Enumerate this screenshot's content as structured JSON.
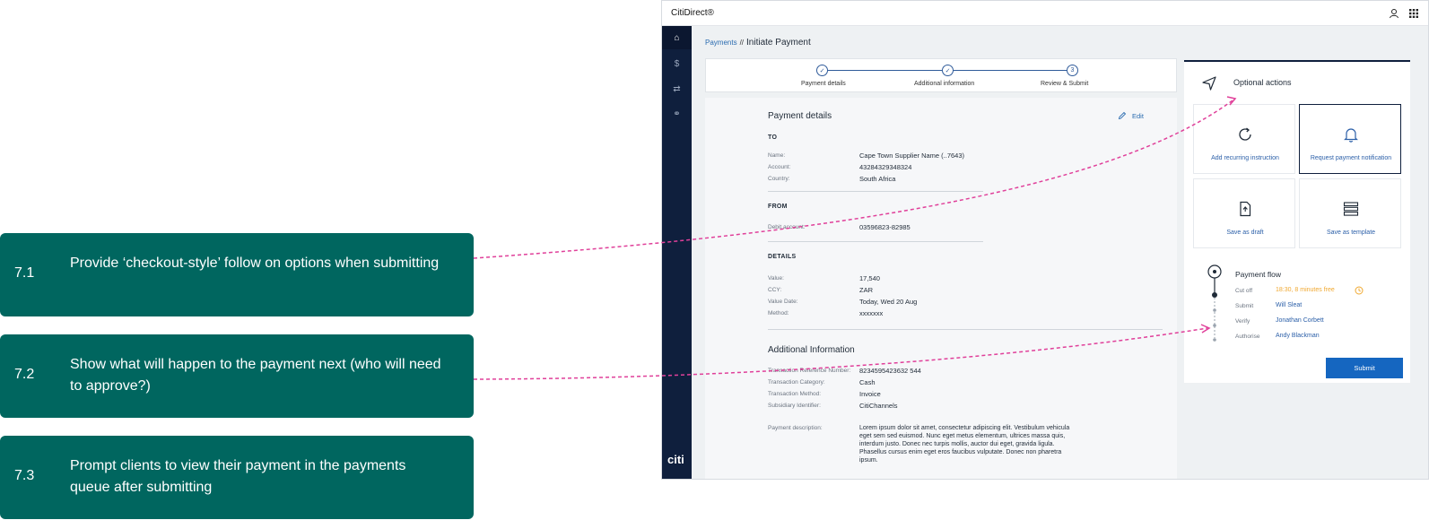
{
  "callouts": [
    {
      "num": "7.1",
      "text": "Provide ‘checkout-style’ follow on options when submitting"
    },
    {
      "num": "7.2",
      "text": "Show what will happen to the payment next (who will need to approve?)"
    },
    {
      "num": "7.3",
      "text": "Prompt clients to view their payment in the payments queue after submitting"
    }
  ],
  "app": {
    "brand": "CitiDirect®",
    "logo": "citi",
    "icons": {
      "user": "user-icon",
      "apps": "apps-grid-icon"
    },
    "sidebar": [
      {
        "icon": "home-icon",
        "glyph": "⌂"
      },
      {
        "icon": "dollar-icon",
        "glyph": "$"
      },
      {
        "icon": "transfer-icon",
        "glyph": "⇄"
      },
      {
        "icon": "link-icon",
        "glyph": "⚭"
      }
    ]
  },
  "breadcrumb": {
    "parent": "Payments",
    "separator": "//",
    "current": "Initiate Payment"
  },
  "stepper": {
    "steps": [
      {
        "label": "Payment details",
        "state": "done",
        "mark": "✓"
      },
      {
        "label": "Additional information",
        "state": "done",
        "mark": "✓"
      },
      {
        "label": "Review & Submit",
        "state": "current",
        "mark": "3"
      }
    ]
  },
  "details": {
    "title": "Payment details",
    "edit": "Edit",
    "to": {
      "heading": "TO",
      "rows": [
        {
          "label": "Name:",
          "value": "Cape Town Supplier Name (..7643)"
        },
        {
          "label": "Account:",
          "value": "43284329348324"
        },
        {
          "label": "Country:",
          "value": "South Africa"
        }
      ]
    },
    "from": {
      "heading": "FROM",
      "rows": [
        {
          "label": "Debit account:",
          "value": "03596823-82985"
        }
      ]
    },
    "info": {
      "heading": "DETAILS",
      "rows": [
        {
          "label": "Value:",
          "value": "17,540"
        },
        {
          "label": "CCY:",
          "value": "ZAR"
        },
        {
          "label": "Value Date:",
          "value": "Today, Wed 20 Aug"
        },
        {
          "label": "Method:",
          "value": "xxxxxxx"
        }
      ]
    },
    "additional": {
      "heading": "Additional Information",
      "rows": [
        {
          "label": "Transaction Reference Number:",
          "value": "8234595423632 544"
        },
        {
          "label": "Transaction Category:",
          "value": "Cash"
        },
        {
          "label": "Transaction Method:",
          "value": "Invoice"
        },
        {
          "label": "Subsidiary Identifier:",
          "value": "CitiChannels"
        }
      ],
      "description_label": "Payment description:",
      "description": "Lorem ipsum dolor sit amet, consectetur adipiscing elit. Vestibulum vehicula eget sem sed euismod. Nunc eget metus elementum, ultrices massa quis, interdum justo. Donec nec turpis mollis, auctor dui eget, gravida ligula. Phasellus cursus enim eget eros faucibus vulputate. Donec non pharetra ipsum."
    }
  },
  "optional": {
    "title": "Optional actions",
    "tiles": [
      {
        "label": "Add recurring instruction",
        "icon": "refresh-icon"
      },
      {
        "label": "Request payment notification",
        "icon": "bell-icon"
      },
      {
        "label": "Save as draft",
        "icon": "document-icon"
      },
      {
        "label": "Save as template",
        "icon": "template-icon"
      }
    ]
  },
  "flow": {
    "title": "Payment flow",
    "rows": [
      {
        "label": "Cut off",
        "value": "18:30, 8 minutes free",
        "color": "#f0a830"
      },
      {
        "label": "Submit",
        "value": "Will Sleat"
      },
      {
        "label": "Verify",
        "value": "Jonathan Corbett"
      },
      {
        "label": "Authorise",
        "value": "Andy Blackman"
      }
    ]
  },
  "submit": "Submit",
  "colors": {
    "callout": "#00665f",
    "arrow": "#e0409a",
    "sidebar": "#0f1f3d",
    "link": "#2b5fa8",
    "button": "#1566c0"
  }
}
